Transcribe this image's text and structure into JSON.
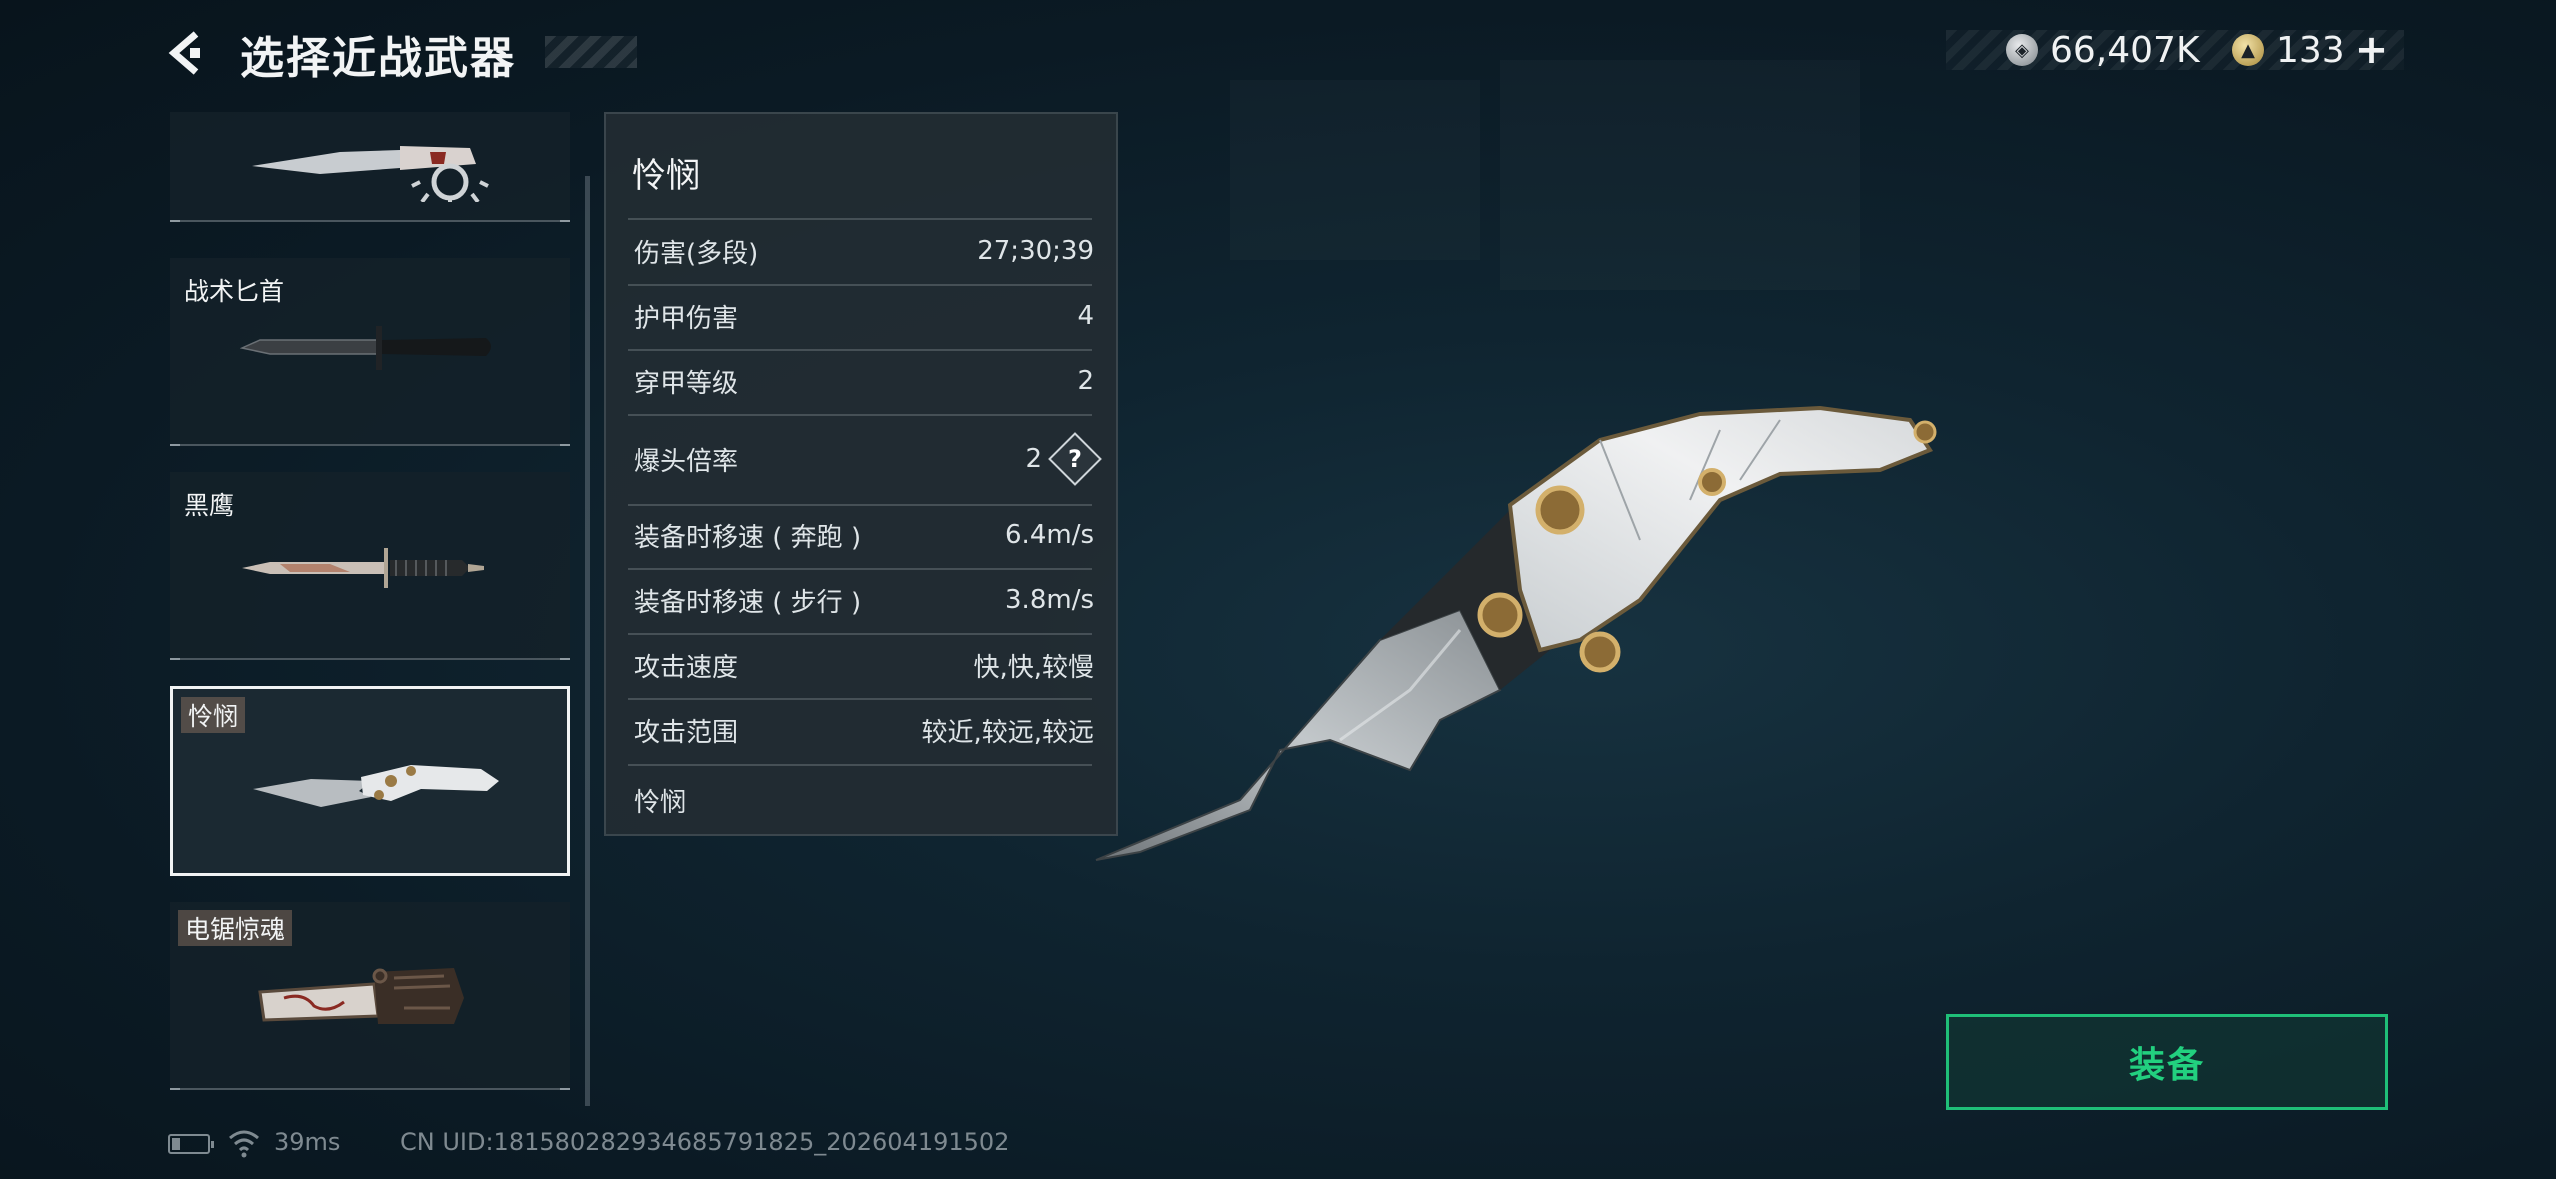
{
  "header": {
    "title": "选择近战武器"
  },
  "currency": {
    "silver_icon": "silver-coin-icon",
    "silver_value": "66,407K",
    "gold_icon": "gold-coin-icon",
    "gold_value": "133",
    "plus_label": "+"
  },
  "weapons": [
    {
      "name": "",
      "icon": "spiked-knuckle-knife-icon",
      "selected": false
    },
    {
      "name": "战术匕首",
      "icon": "tactical-dagger-icon",
      "selected": false
    },
    {
      "name": "黑鹰",
      "icon": "black-hawk-dagger-icon",
      "selected": false
    },
    {
      "name": "怜悯",
      "icon": "mercy-knife-icon",
      "selected": true
    },
    {
      "name": "电锯惊魂",
      "icon": "chainsaw-icon",
      "selected": false
    }
  ],
  "detail": {
    "title": "怜悯",
    "stats": [
      {
        "label": "伤害(多段)",
        "value": "27;30;39"
      },
      {
        "label": "护甲伤害",
        "value": "4"
      },
      {
        "label": "穿甲等级",
        "value": "2"
      },
      {
        "label": "爆头倍率",
        "value": "2",
        "help": "?"
      },
      {
        "label": "装备时移速 ( 奔跑 )",
        "value": "6.4m/s"
      },
      {
        "label": "装备时移速 ( 步行 )",
        "value": "3.8m/s"
      },
      {
        "label": "攻击速度",
        "value": "快,快,较慢"
      },
      {
        "label": "攻击范围",
        "value": "较近,较远,较远"
      }
    ],
    "footer_name": "怜悯"
  },
  "equip_button": {
    "label": "装备",
    "color": "#22d07f"
  },
  "status": {
    "ping": "39ms",
    "uid": "CN UID:18158028293468579182​5_202604191502"
  }
}
